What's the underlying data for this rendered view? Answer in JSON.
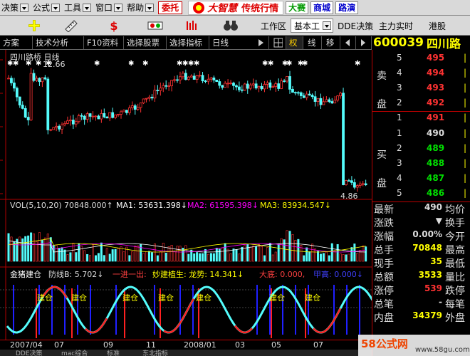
{
  "menu": {
    "items": [
      "决策",
      "公式",
      "工具",
      "窗口",
      "帮助"
    ],
    "button": "委托"
  },
  "brand": {
    "name": "大智慧",
    "slogan": "传统行情"
  },
  "side_buttons": [
    "大赛",
    "商城",
    "路演"
  ],
  "toolbar": {
    "workspace": "工作区",
    "basic": "基本工",
    "dde": "DDE决策",
    "main_realtime": "主力实时",
    "hk_stock": "港股"
  },
  "tabs": [
    "方案",
    "技术分析",
    "F10资料",
    "选择股票",
    "选择指标",
    "日线",
    "权",
    "线",
    "移"
  ],
  "stock": {
    "code": "600039",
    "name": "四川路"
  },
  "chart": {
    "title": "四川路桥 日线",
    "high_label": "12.66",
    "low_label": "4.86",
    "vol_label": "VOL(5,10,20)",
    "vol_value": "70848.000↑",
    "ma1": "MA1: 53631.398↓",
    "ma2": "MA2: 61595.398↓",
    "ma3": "MA3: 83934.547↓",
    "ind_label": "金猪建仓",
    "ind_defense": "防线B: 5.702↓",
    "ind_jinchu": "一进一出:",
    "ind_miaojian": "妙建植生: 龙势: 14.341↓",
    "ind_dadi": "大底: 0.000,",
    "ind_jiaju": "甲高: 0.000↓",
    "jiancang": "建仓",
    "dates": [
      "2007/04",
      "07",
      "09",
      "11",
      "2008/01",
      "03",
      "05",
      "07"
    ],
    "bottom_tabs": [
      "DDE决策",
      "mac综合",
      "标准",
      "东北指标"
    ],
    "colors": {
      "up": "#ff3232",
      "down": "#54fcfc",
      "ma1": "#ffffff",
      "ma2": "#ff00ff",
      "ma3": "#ffff00",
      "grid": "#b00000"
    }
  },
  "order_book": {
    "sell_label": [
      "卖",
      "盘"
    ],
    "buy_label": [
      "买",
      "盘"
    ],
    "asks": [
      {
        "level": "5",
        "price": "495"
      },
      {
        "level": "4",
        "price": "494"
      },
      {
        "level": "3",
        "price": "493"
      },
      {
        "level": "2",
        "price": "492"
      },
      {
        "level": "1",
        "price": "491"
      }
    ],
    "bids": [
      {
        "level": "1",
        "price": "490"
      },
      {
        "level": "2",
        "price": "489"
      },
      {
        "level": "3",
        "price": "488"
      },
      {
        "level": "4",
        "price": "487"
      },
      {
        "level": "5",
        "price": "486"
      }
    ]
  },
  "stats": [
    {
      "label": "最新",
      "value": "490",
      "label2": "均价"
    },
    {
      "label": "涨跌",
      "value": "▼",
      "label2": "换手"
    },
    {
      "label": "涨幅",
      "value": "0.00%",
      "label2": "今开"
    },
    {
      "label": "总手",
      "value": "70848",
      "label2": "最高"
    },
    {
      "label": "现手",
      "value": "35",
      "label2": "最低"
    },
    {
      "label": "总额",
      "value": "3533",
      "label2": "量比"
    },
    {
      "label": "涨停",
      "value": "539",
      "label2": "跌停"
    },
    {
      "label": "总笔",
      "value": "-",
      "label2": "每笔"
    },
    {
      "label": "内盘",
      "value": "34379",
      "label2": "外盘"
    }
  ],
  "watermark": {
    "text": "58公式网",
    "url": "www.58gu.com"
  }
}
